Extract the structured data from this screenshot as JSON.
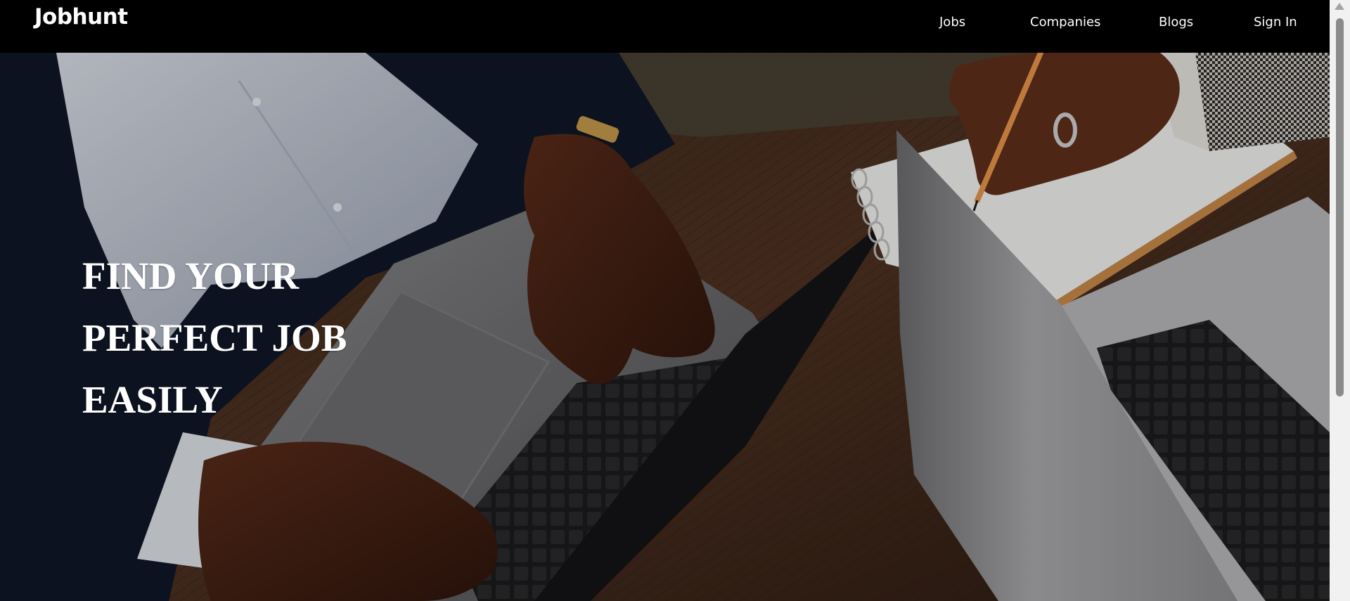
{
  "navbar": {
    "brand": "Jobhunt",
    "links": [
      {
        "label": "Jobs"
      },
      {
        "label": "Companies"
      },
      {
        "label": "Blogs"
      },
      {
        "label": "Sign In"
      }
    ]
  },
  "hero": {
    "title_lines": [
      "FIND YOUR",
      "PERFECT JOB",
      "EASILY"
    ],
    "background_description_icon": "office-laptops-photo"
  },
  "colors": {
    "navbar_bg": "#000000",
    "text": "#ffffff",
    "desk": "#4a2f20"
  }
}
